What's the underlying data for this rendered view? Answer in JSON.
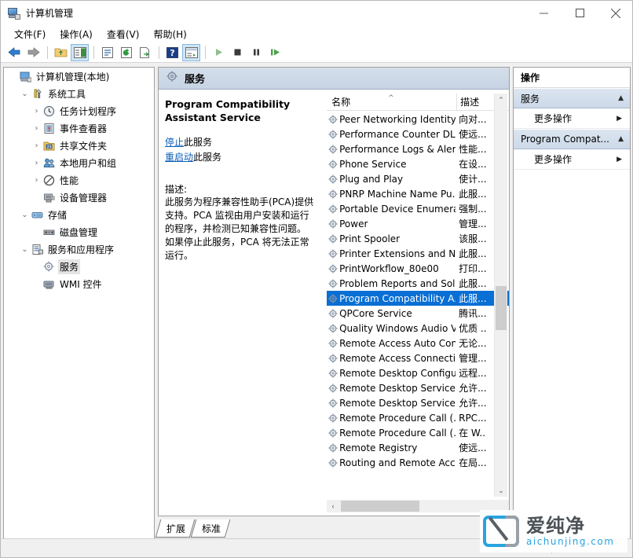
{
  "window": {
    "title": "计算机管理",
    "icon": "computer-management-icon",
    "minimize_label": "最小化",
    "maximize_label": "最大化",
    "close_label": "关闭"
  },
  "menubar": {
    "items": [
      {
        "label": "文件(F)",
        "name": "menu-file"
      },
      {
        "label": "操作(A)",
        "name": "menu-action"
      },
      {
        "label": "查看(V)",
        "name": "menu-view"
      },
      {
        "label": "帮助(H)",
        "name": "menu-help"
      }
    ]
  },
  "toolbar": {
    "buttons": [
      {
        "name": "back-button",
        "icon": "arrow-left-icon",
        "pressed": false
      },
      {
        "name": "forward-button",
        "icon": "arrow-right-icon",
        "pressed": false
      },
      {
        "name": "up-folder-button",
        "icon": "folder-up-icon",
        "pressed": false
      },
      {
        "name": "show-hide-tree-button",
        "icon": "tree-pane-icon",
        "pressed": true
      },
      {
        "name": "properties-button",
        "icon": "properties-icon",
        "pressed": false
      },
      {
        "name": "refresh-button",
        "icon": "refresh-icon",
        "pressed": false
      },
      {
        "name": "export-list-button",
        "icon": "export-icon",
        "pressed": false
      },
      {
        "name": "help-button",
        "icon": "help-icon",
        "pressed": false
      },
      {
        "name": "show-action-pane-button",
        "icon": "action-pane-icon",
        "pressed": true
      },
      {
        "name": "start-service-button",
        "icon": "play-icon",
        "pressed": false
      },
      {
        "name": "stop-service-button",
        "icon": "stop-icon",
        "pressed": false
      },
      {
        "name": "pause-service-button",
        "icon": "pause-icon",
        "pressed": false
      },
      {
        "name": "restart-service-button",
        "icon": "restart-icon",
        "pressed": false
      }
    ]
  },
  "tree": {
    "items": [
      {
        "label": "计算机管理(本地)",
        "indent": 0,
        "chevron": "",
        "icon": "computer-icon",
        "selected": false
      },
      {
        "label": "系统工具",
        "indent": 1,
        "chevron": "⌄",
        "icon": "tools-icon",
        "selected": false
      },
      {
        "label": "任务计划程序",
        "indent": 2,
        "chevron": "›",
        "icon": "clock-icon",
        "selected": false
      },
      {
        "label": "事件查看器",
        "indent": 2,
        "chevron": "›",
        "icon": "event-viewer-icon",
        "selected": false
      },
      {
        "label": "共享文件夹",
        "indent": 2,
        "chevron": "›",
        "icon": "shared-folder-icon",
        "selected": false
      },
      {
        "label": "本地用户和组",
        "indent": 2,
        "chevron": "›",
        "icon": "users-groups-icon",
        "selected": false
      },
      {
        "label": "性能",
        "indent": 2,
        "chevron": "›",
        "icon": "performance-icon",
        "selected": false
      },
      {
        "label": "设备管理器",
        "indent": 2,
        "chevron": "",
        "icon": "device-manager-icon",
        "selected": false
      },
      {
        "label": "存储",
        "indent": 1,
        "chevron": "⌄",
        "icon": "storage-icon",
        "selected": false
      },
      {
        "label": "磁盘管理",
        "indent": 2,
        "chevron": "",
        "icon": "disk-management-icon",
        "selected": false
      },
      {
        "label": "服务和应用程序",
        "indent": 1,
        "chevron": "⌄",
        "icon": "services-apps-icon",
        "selected": false
      },
      {
        "label": "服务",
        "indent": 2,
        "chevron": "",
        "icon": "service-gear-icon",
        "selected": true
      },
      {
        "label": "WMI 控件",
        "indent": 2,
        "chevron": "",
        "icon": "wmi-icon",
        "selected": false
      }
    ]
  },
  "mid": {
    "header_title": "服务",
    "header_icon": "service-gear-icon",
    "detail": {
      "service_name": "Program Compatibility Assistant Service",
      "stop_link_text": "停止",
      "stop_link_suffix": "此服务",
      "restart_link_text": "重启动",
      "restart_link_suffix": "此服务",
      "description_label": "描述:",
      "description": "此服务为程序兼容性助手(PCA)提供支持。PCA 监视由用户安装和运行的程序，并检测已知兼容性问题。如果停止此服务，PCA 将无法正常运行。"
    },
    "list": {
      "columns": [
        {
          "label": "名称",
          "name": "column-name",
          "sort_mark": "^"
        },
        {
          "label": "描述",
          "name": "column-description"
        }
      ],
      "rows": [
        {
          "name": "Peer Networking Identity...",
          "desc": "向对...",
          "selected": false
        },
        {
          "name": "Performance Counter DL...",
          "desc": "使远...",
          "selected": false
        },
        {
          "name": "Performance Logs & Aler...",
          "desc": "性能...",
          "selected": false
        },
        {
          "name": "Phone Service",
          "desc": "在设...",
          "selected": false
        },
        {
          "name": "Plug and Play",
          "desc": "使计...",
          "selected": false
        },
        {
          "name": "PNRP Machine Name Pu...",
          "desc": "此服...",
          "selected": false
        },
        {
          "name": "Portable Device Enumera...",
          "desc": "强制...",
          "selected": false
        },
        {
          "name": "Power",
          "desc": "管理...",
          "selected": false
        },
        {
          "name": "Print Spooler",
          "desc": "该服...",
          "selected": false
        },
        {
          "name": "Printer Extensions and N...",
          "desc": "此服...",
          "selected": false
        },
        {
          "name": "PrintWorkflow_80e00",
          "desc": "打印...",
          "selected": false
        },
        {
          "name": "Problem Reports and Sol...",
          "desc": "此服...",
          "selected": false
        },
        {
          "name": "Program Compatibility A...",
          "desc": "此服...",
          "selected": true
        },
        {
          "name": "QPCore Service",
          "desc": "腾讯...",
          "selected": false
        },
        {
          "name": "Quality Windows Audio V...",
          "desc": "优质 ..",
          "selected": false
        },
        {
          "name": "Remote Access Auto Con...",
          "desc": "无论...",
          "selected": false
        },
        {
          "name": "Remote Access Connecti...",
          "desc": "管理...",
          "selected": false
        },
        {
          "name": "Remote Desktop Configu...",
          "desc": "远程...",
          "selected": false
        },
        {
          "name": "Remote Desktop Services",
          "desc": "允许...",
          "selected": false
        },
        {
          "name": "Remote Desktop Service...",
          "desc": "允许...",
          "selected": false
        },
        {
          "name": "Remote Procedure Call (...",
          "desc": "RPC...",
          "selected": false
        },
        {
          "name": "Remote Procedure Call (...",
          "desc": "在 W..",
          "selected": false
        },
        {
          "name": "Remote Registry",
          "desc": "使远...",
          "selected": false
        },
        {
          "name": "Routing and Remote Acc...",
          "desc": "在局...",
          "selected": false
        }
      ]
    }
  },
  "tabs": [
    {
      "label": "扩展",
      "name": "tab-extended",
      "active": false
    },
    {
      "label": "标准",
      "name": "tab-standard",
      "active": true
    }
  ],
  "actions": {
    "title": "操作",
    "groups": [
      {
        "label": "服务",
        "name": "action-group-services",
        "caret": "▲",
        "items": [
          {
            "label": "更多操作",
            "name": "action-more-services",
            "caret": "▶"
          }
        ]
      },
      {
        "label": "Program Compat...",
        "name": "action-group-program-compat",
        "caret": "▲",
        "items": [
          {
            "label": "更多操作",
            "name": "action-more-program-compat",
            "caret": "▶"
          }
        ]
      }
    ]
  },
  "watermark": {
    "cn": "爱纯净",
    "en": "aichunjing.com"
  },
  "colors": {
    "selection_blue": "#0a6fd4",
    "header_blue": "#c6d3e3",
    "link_blue": "#0b5fb8",
    "accent_cyan": "#29a3e0"
  }
}
